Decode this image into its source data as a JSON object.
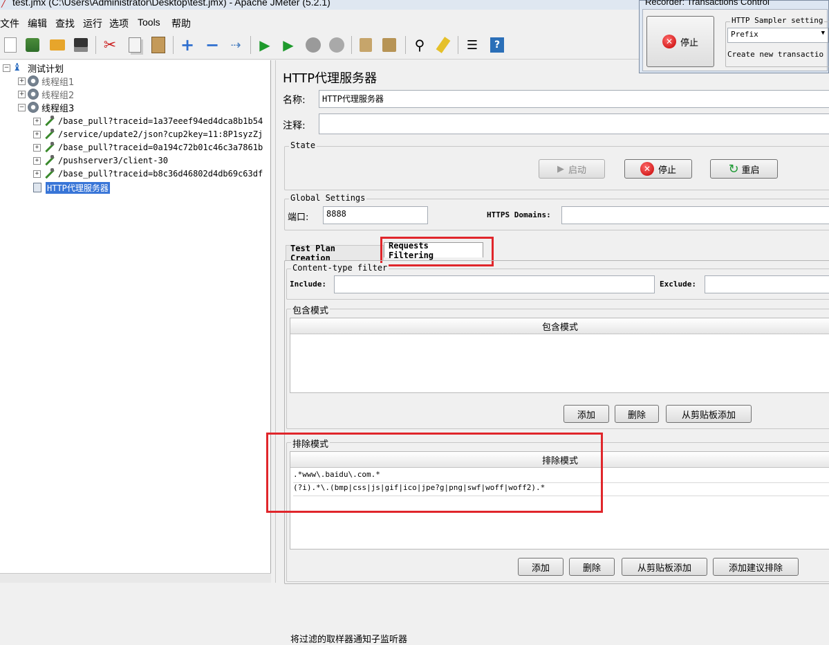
{
  "window": {
    "title": "test.jmx (C:\\Users\\Administrator\\Desktop\\test.jmx) - Apache JMeter (5.2.1)"
  },
  "menu": [
    "文件",
    "编辑",
    "查找",
    "运行",
    "选项",
    "Tools",
    "帮助"
  ],
  "toolbar_icons": [
    "new-icon",
    "templates-icon",
    "open-icon",
    "save-icon",
    "cut-icon",
    "copy-icon",
    "paste-icon",
    "expand-icon",
    "collapse-icon",
    "toggle-icon",
    "start-icon",
    "start-no-pause-icon",
    "stop-icon",
    "shutdown-icon",
    "clear-icon",
    "clear-all-icon",
    "search-icon",
    "reset-search-icon",
    "function-helper-icon",
    "help-icon"
  ],
  "tree": {
    "root": "测试计划",
    "groups": [
      "线程组1",
      "线程组2",
      "线程组3"
    ],
    "samplers": [
      "/base_pull?traceid=1a37eeef94ed4dca8b1b54",
      "/service/update2/json?cup2key=11:8P1syzZj",
      "/base_pull?traceid=0a194c72b01c46c3a7861b",
      "/pushserver3/client-30",
      "/base_pull?traceid=b8c36d46802d4db69c63df"
    ],
    "proxy": "HTTP代理服务器"
  },
  "panel": {
    "title": "HTTP代理服务器",
    "name_label": "名称:",
    "name_value": "HTTP代理服务器",
    "comment_label": "注释:",
    "comment_value": "",
    "state_label": "State",
    "start_button": "启动",
    "stop_button": "停止",
    "restart_button": "重启",
    "global_label": "Global Settings",
    "port_label": "端口:",
    "port_value": "8888",
    "https_label": "HTTPS Domains:",
    "https_value": "",
    "tabs": [
      "Test Plan Creation",
      "Requests Filtering"
    ],
    "content_type_label": "Content-type filter",
    "include_label": "Include:",
    "exclude_label": "Exclude:",
    "include_section": "包含模式",
    "include_header": "包含模式",
    "include_add": "添加",
    "include_delete": "删除",
    "include_paste": "从剪贴板添加",
    "exclude_section": "排除模式",
    "exclude_header": "排除模式",
    "exclude_rows": [
      ".*www\\.baidu\\.com.*",
      "(?i).*\\.(bmp|css|js|gif|ico|jpe?g|png|swf|woff|woff2).*"
    ],
    "exclude_add": "添加",
    "exclude_delete": "删除",
    "exclude_paste": "从剪贴板添加",
    "exclude_suggested": "添加建议排除",
    "notify_label": "将过滤的取样器通知子监听器"
  },
  "recorder": {
    "title": "Recorder: Transactions Control",
    "stop_button": "停止",
    "sampler_settings": "HTTP Sampler setting",
    "prefix_value": "Prefix",
    "create_label": "Create new transactio"
  }
}
